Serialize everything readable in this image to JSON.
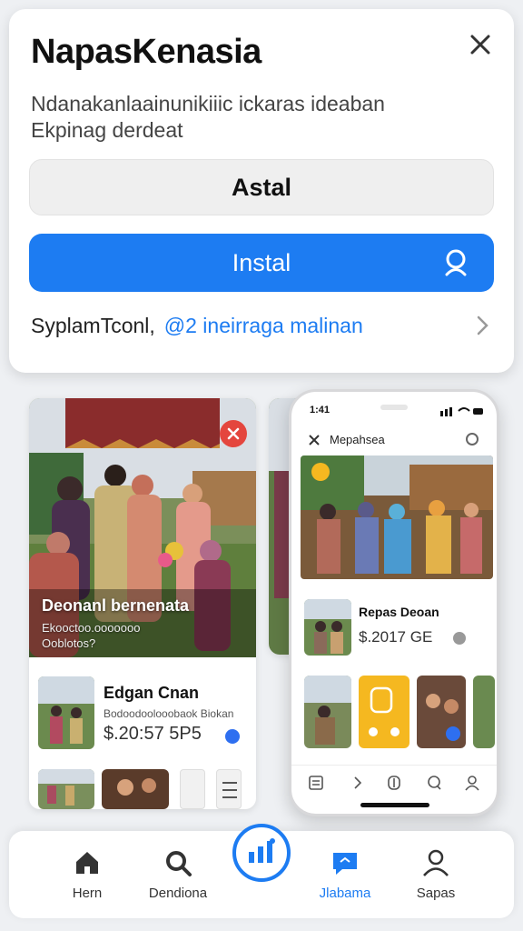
{
  "sheet": {
    "title": "NapasKenasia",
    "description": "Ndanakanlaainunikiiic ickaras ideaban Ekpinag derdeat",
    "secondary_button": "Astal",
    "primary_button": "Instal",
    "link_prefix": "SyplamTconl,",
    "link_text": "@2 ineirraga malinan"
  },
  "card_a": {
    "hero_caption": "Deonanl bernenata",
    "hero_sub": "Ekooctoo.ooooooo Ooblotos?",
    "item_title": "Edgan Cnan",
    "item_sub": "Bodoodoolooobaok Biokan",
    "item_price": "$.20:57 5P5"
  },
  "phone": {
    "status_time": "1:41",
    "title": "Mepahsea",
    "item_title": "Repas Deoan",
    "item_price": "$.2017 GE"
  },
  "nav": {
    "items": [
      {
        "label": "Hern",
        "icon": "home-icon"
      },
      {
        "label": "Dendiona",
        "icon": "search-icon"
      },
      {
        "label": "",
        "icon": "chart-icon"
      },
      {
        "label": "Jlabama",
        "icon": "chat-icon"
      },
      {
        "label": "Sapas",
        "icon": "user-icon"
      }
    ]
  },
  "colors": {
    "accent": "#1d7cf2",
    "red": "#e4463e",
    "yellow": "#f5b820"
  }
}
